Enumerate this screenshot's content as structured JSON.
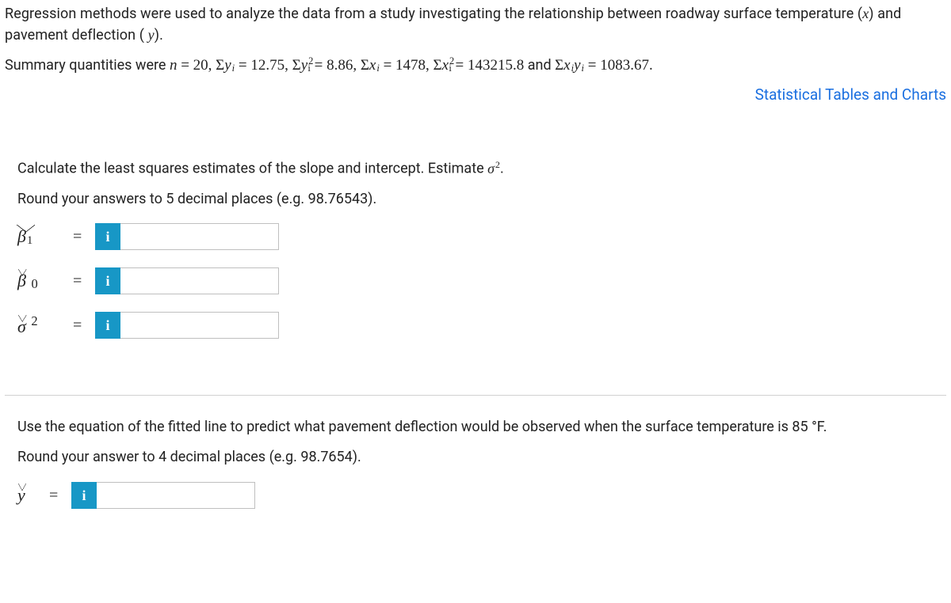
{
  "intro": {
    "text_a": "Regression methods were used to analyze the data from a study investigating the relationship between roadway surface temperature (",
    "var_x": "x",
    "text_b": ") and pavement deflection (",
    "var_y": " y",
    "text_c": ")."
  },
  "summary": {
    "lead": "Summary quantities were ",
    "n": "20",
    "sum_yi": "12.75",
    "sum_yi2": "8.86",
    "sum_xi": "1478",
    "sum_xi2": "143215.8",
    "and": " and ",
    "sum_xiyi": "1083.67",
    "period": "."
  },
  "link": {
    "label": "Statistical Tables and Charts"
  },
  "part1": {
    "prompt_a": "Calculate the least squares estimates of the slope and intercept. Estimate ",
    "sigma2": "σ",
    "prompt_b": ".",
    "round": "Round your answers to 5 decimal places (e.g. 98.76543).",
    "labels": {
      "beta1": "β",
      "beta1_sub": "1",
      "beta0": "β",
      "beta0_sub": "0",
      "sigma": "σ",
      "sigma_sup": "2"
    },
    "eq": "="
  },
  "part2": {
    "prompt": "Use the equation of the fitted line to predict what pavement deflection would be observed when the surface temperature is 85 °F.",
    "round": "Round your answer to 4 decimal places (e.g. 98.7654).",
    "label_y": "y",
    "eq": "="
  },
  "icons": {
    "info": "i"
  }
}
